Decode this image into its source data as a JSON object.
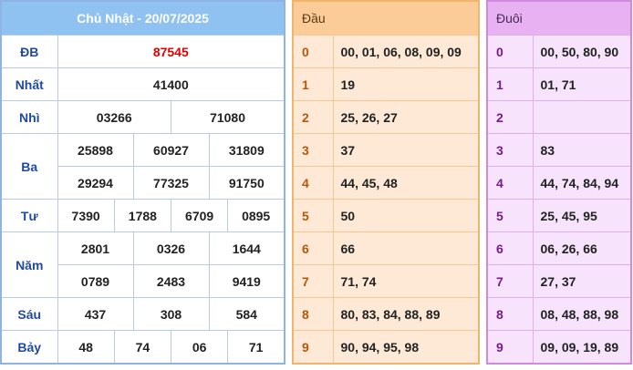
{
  "results": {
    "title": "Chủ Nhật - 20/07/2025",
    "prizes": {
      "db": {
        "label": "ĐB",
        "numbers": [
          "87545"
        ]
      },
      "nhat": {
        "label": "Nhất",
        "numbers": [
          "41400"
        ]
      },
      "nhi": {
        "label": "Nhì",
        "numbers": [
          "03266",
          "71080"
        ]
      },
      "ba": {
        "label": "Ba",
        "numbers": [
          "25898",
          "60927",
          "31809",
          "29294",
          "77325",
          "91750"
        ]
      },
      "tu": {
        "label": "Tư",
        "numbers": [
          "7390",
          "1788",
          "6709",
          "0895"
        ]
      },
      "nam": {
        "label": "Năm",
        "numbers": [
          "2801",
          "0326",
          "1644",
          "0789",
          "2483",
          "9419"
        ]
      },
      "sau": {
        "label": "Sáu",
        "numbers": [
          "437",
          "308",
          "584"
        ]
      },
      "bay": {
        "label": "Bảy",
        "numbers": [
          "48",
          "74",
          "06",
          "71"
        ]
      }
    }
  },
  "head_table": {
    "header": "Đầu",
    "rows": [
      {
        "digit": "0",
        "nums": "00, 01, 06, 08, 09, 09"
      },
      {
        "digit": "1",
        "nums": "19"
      },
      {
        "digit": "2",
        "nums": "25, 26, 27"
      },
      {
        "digit": "3",
        "nums": "37"
      },
      {
        "digit": "4",
        "nums": "44, 45, 48"
      },
      {
        "digit": "5",
        "nums": "50"
      },
      {
        "digit": "6",
        "nums": "66"
      },
      {
        "digit": "7",
        "nums": "71, 74"
      },
      {
        "digit": "8",
        "nums": "80, 83, 84, 88, 89"
      },
      {
        "digit": "9",
        "nums": "90, 94, 95, 98"
      }
    ]
  },
  "tail_table": {
    "header": "Đuôi",
    "rows": [
      {
        "digit": "0",
        "nums": "00, 50, 80, 90"
      },
      {
        "digit": "1",
        "nums": "01, 71"
      },
      {
        "digit": "2",
        "nums": ""
      },
      {
        "digit": "3",
        "nums": "83"
      },
      {
        "digit": "4",
        "nums": "44, 74, 84, 94"
      },
      {
        "digit": "5",
        "nums": "25, 45, 95"
      },
      {
        "digit": "6",
        "nums": "06, 26, 66"
      },
      {
        "digit": "7",
        "nums": "27, 37"
      },
      {
        "digit": "8",
        "nums": "08, 48, 88, 98"
      },
      {
        "digit": "9",
        "nums": "09, 09, 19, 89"
      }
    ]
  },
  "colors": {
    "results_header": "#8fc1f1",
    "special_prize": "#e10000",
    "label_text": "#1f4a9e",
    "head_bg": "#fde9d5",
    "tail_bg": "#f7e3fb"
  }
}
